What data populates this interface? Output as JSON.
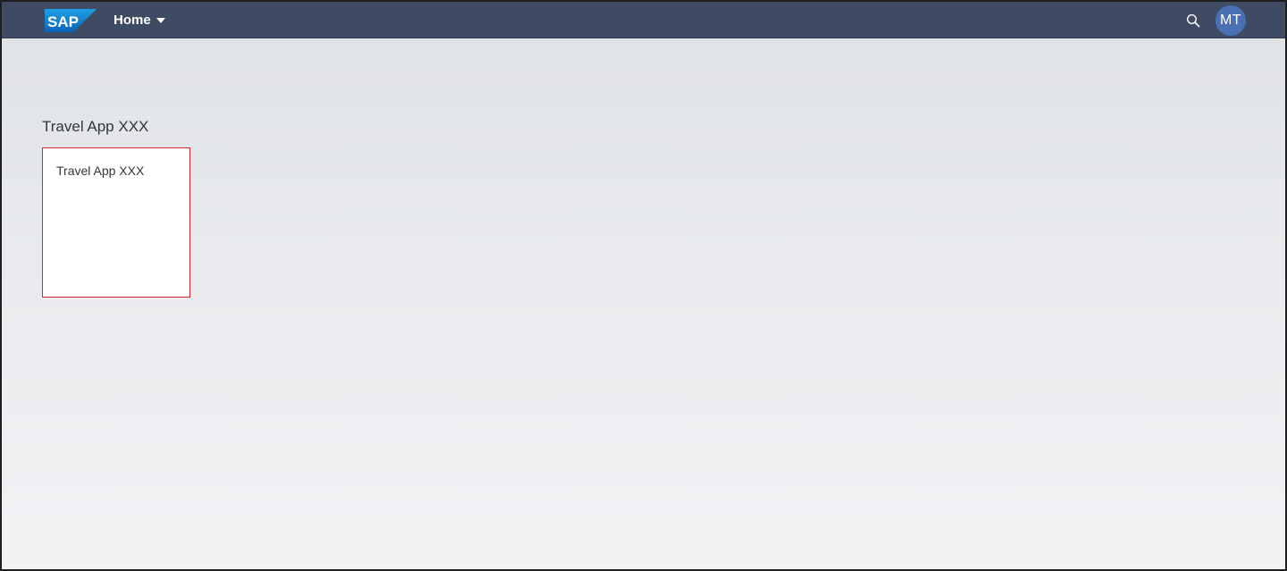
{
  "shellbar": {
    "logo_text": "SAP",
    "home_label": "Home",
    "avatar_initials": "MT"
  },
  "main": {
    "group_title": "Travel App XXX",
    "tiles": [
      {
        "title": "Travel App XXX"
      }
    ]
  },
  "colors": {
    "shellbar_bg": "#3e4b63",
    "avatar_bg": "#4a6fb3",
    "tile_highlight_border": "#e0262c"
  }
}
